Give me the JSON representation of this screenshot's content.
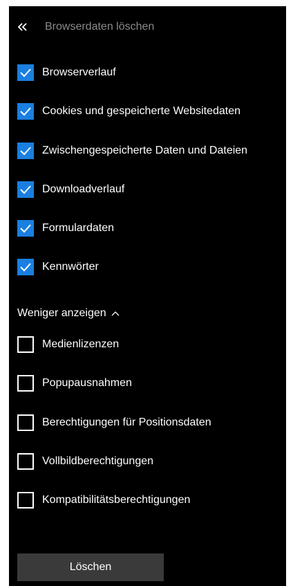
{
  "header": {
    "back_icon": "double-chevron-left-icon",
    "title": "Browserdaten löschen"
  },
  "checked_items": [
    {
      "label": "Browserverlauf",
      "checked": true
    },
    {
      "label": "Cookies und gespeicherte Websitedaten",
      "checked": true
    },
    {
      "label": "Zwischengespeicherte Daten und Dateien",
      "checked": true
    },
    {
      "label": "Downloadverlauf",
      "checked": true
    },
    {
      "label": "Formulardaten",
      "checked": true
    },
    {
      "label": "Kennwörter",
      "checked": true
    }
  ],
  "toggle": {
    "label": "Weniger anzeigen",
    "icon": "chevron-up-icon"
  },
  "unchecked_items": [
    {
      "label": "Medienlizenzen",
      "checked": false
    },
    {
      "label": "Popupausnahmen",
      "checked": false
    },
    {
      "label": "Berechtigungen für Positionsdaten",
      "checked": false
    },
    {
      "label": "Vollbildberechtigungen",
      "checked": false
    },
    {
      "label": "Kompatibilitätsberechtigungen",
      "checked": false
    }
  ],
  "actions": {
    "delete_label": "Löschen"
  },
  "colors": {
    "panel_background": "#000000",
    "checkbox_accent": "#1a7fe0",
    "button_background": "#3a3a3a",
    "muted_text": "#8a8a8a"
  }
}
